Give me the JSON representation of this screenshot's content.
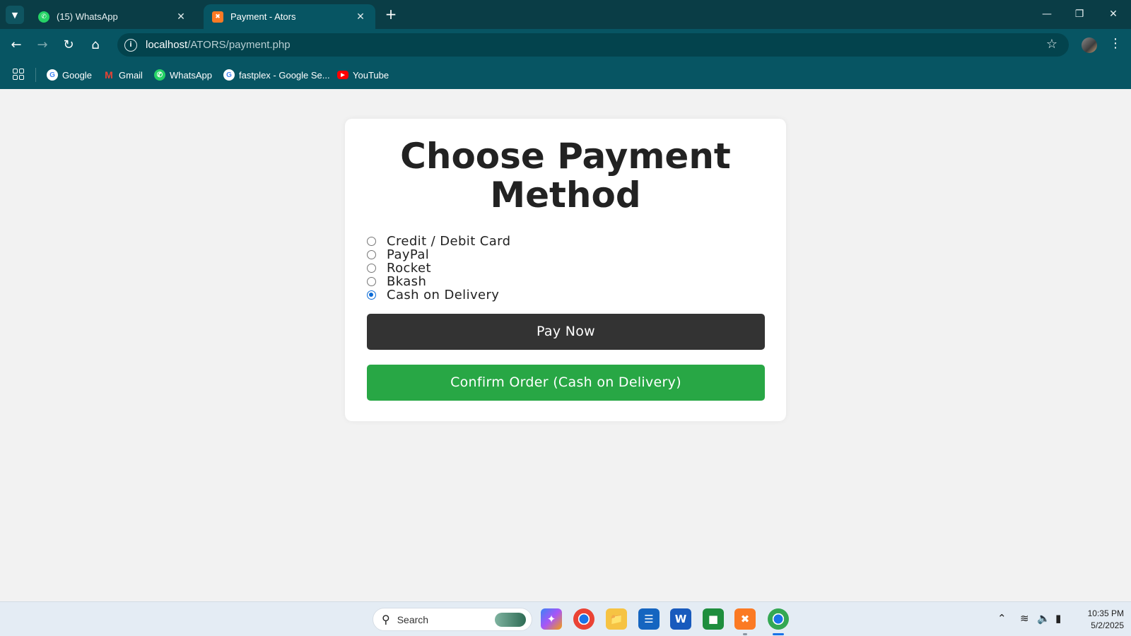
{
  "browser": {
    "tabs": [
      {
        "title": "(15) WhatsApp",
        "icon": "whatsapp-icon",
        "active": false
      },
      {
        "title": "Payment - Ators",
        "icon": "xampp-icon",
        "active": true
      }
    ],
    "url_host": "localhost",
    "url_path": "/ATORS/payment.php",
    "bookmarks": [
      {
        "label": "Google",
        "icon": "google-icon"
      },
      {
        "label": "Gmail",
        "icon": "gmail-icon"
      },
      {
        "label": "WhatsApp",
        "icon": "whatsapp-icon"
      },
      {
        "label": "fastplex - Google Se...",
        "icon": "google-icon"
      },
      {
        "label": "YouTube",
        "icon": "youtube-icon"
      }
    ]
  },
  "page": {
    "heading_line1": "Choose Payment",
    "heading_line2": "Method",
    "payment_options": [
      {
        "label": "Credit / Debit Card",
        "checked": false
      },
      {
        "label": "PayPal",
        "checked": false
      },
      {
        "label": "Rocket",
        "checked": false
      },
      {
        "label": "Bkash",
        "checked": false
      },
      {
        "label": "Cash on Delivery",
        "checked": true
      }
    ],
    "pay_now_label": "Pay Now",
    "confirm_label": "Confirm Order (Cash on Delivery)",
    "colors": {
      "pay_button": "#333333",
      "confirm_button": "#28a745",
      "radio_accent": "#0b6bd6"
    }
  },
  "taskbar": {
    "search_placeholder": "Search",
    "time": "10:35 PM",
    "date": "5/2/2025"
  }
}
